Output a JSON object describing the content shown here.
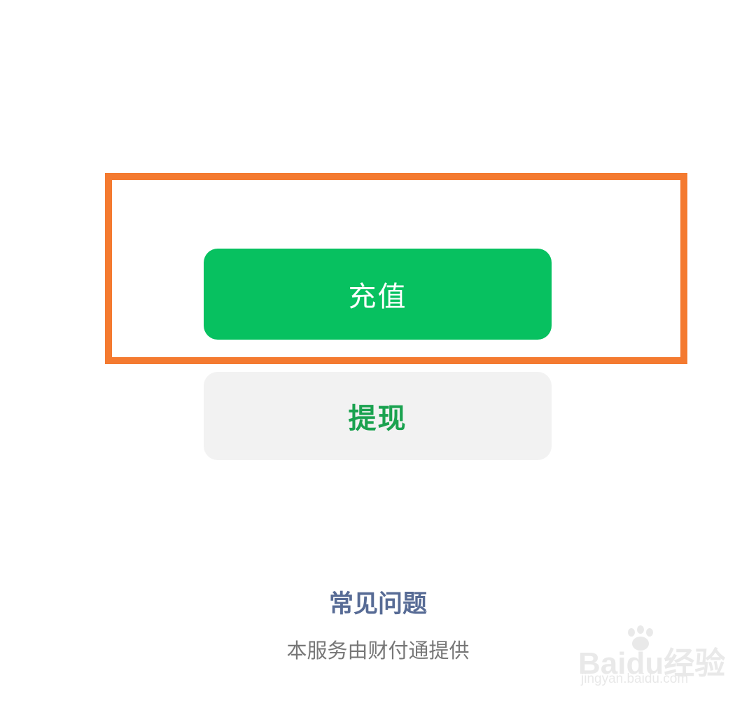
{
  "actions": {
    "recharge_label": "充值",
    "withdraw_label": "提现"
  },
  "footer": {
    "faq_label": "常见问题",
    "provider_note": "本服务由财付通提供"
  },
  "watermark": {
    "brand": "Baidu经验",
    "url": "jingyan.baidu.com"
  },
  "colors": {
    "primary_green": "#07c160",
    "withdraw_text": "#1aa24f",
    "highlight_orange": "#f47a30",
    "faq_link": "#576b95"
  },
  "icons": [
    "baidu-paw-icon"
  ]
}
